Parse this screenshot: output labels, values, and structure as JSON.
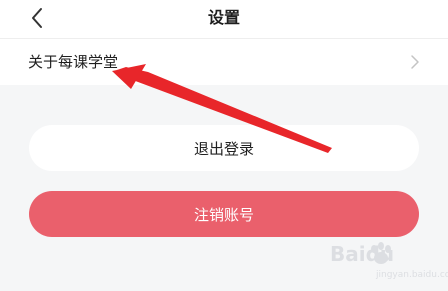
{
  "header": {
    "back_icon": "chevron-left-icon",
    "title": "设置"
  },
  "settings_list": [
    {
      "label": "关于每课学堂",
      "trailing_icon": "chevron-right-icon"
    }
  ],
  "actions": {
    "logout_label": "退出登录",
    "cancel_account_label": "注销账号"
  },
  "colors": {
    "page_background": "#f5f6f7",
    "danger_button": "#ea606c",
    "annotation_arrow": "#e8262a"
  },
  "watermark": {
    "brand": "Baidu",
    "sub": "jingyan.baidu.com"
  }
}
